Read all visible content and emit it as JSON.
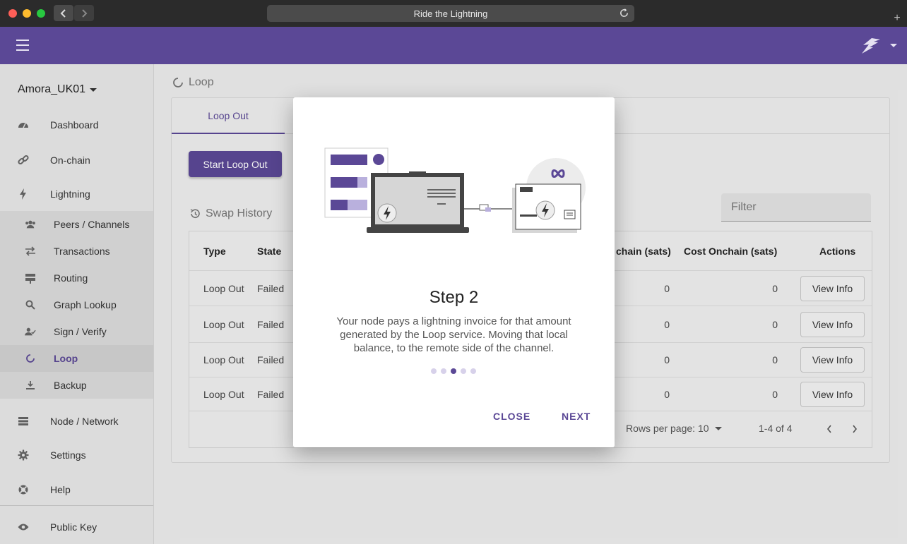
{
  "browser": {
    "url_title": "Ride the Lightning",
    "new_tab": "+"
  },
  "sidebar": {
    "node_name": "Amora_UK01",
    "items": [
      {
        "label": "Dashboard",
        "icon": "dashboard-icon"
      },
      {
        "label": "On-chain",
        "icon": "link-icon"
      },
      {
        "label": "Lightning",
        "icon": "bolt-icon"
      },
      {
        "label": "Peers / Channels",
        "icon": "people-icon"
      },
      {
        "label": "Transactions",
        "icon": "swap-arrows-icon"
      },
      {
        "label": "Routing",
        "icon": "signpost-icon"
      },
      {
        "label": "Graph Lookup",
        "icon": "search-icon"
      },
      {
        "label": "Sign / Verify",
        "icon": "user-check-icon"
      },
      {
        "label": "Loop",
        "icon": "loop-icon"
      },
      {
        "label": "Backup",
        "icon": "download-icon"
      },
      {
        "label": "Node / Network",
        "icon": "server-icon"
      },
      {
        "label": "Settings",
        "icon": "gear-icon"
      },
      {
        "label": "Help",
        "icon": "lifebuoy-icon"
      },
      {
        "label": "Public Key",
        "icon": "eye-icon"
      }
    ]
  },
  "main": {
    "breadcrumb": "Loop",
    "tab_active": "Loop Out",
    "start_button": "Start Loop Out",
    "swap_history_title": "Swap History",
    "filter_placeholder": "Filter",
    "table": {
      "headers": {
        "type": "Type",
        "state": "State",
        "onchain": "chain (sats)",
        "cost_onchain": "Cost Onchain (sats)",
        "actions": "Actions"
      },
      "rows": [
        {
          "type": "Loop Out",
          "state": "Failed",
          "onchain": "0",
          "cost_onchain": "0",
          "action": "View Info"
        },
        {
          "type": "Loop Out",
          "state": "Failed",
          "onchain": "0",
          "cost_onchain": "0",
          "action": "View Info"
        },
        {
          "type": "Loop Out",
          "state": "Failed",
          "onchain": "0",
          "cost_onchain": "0",
          "action": "View Info"
        },
        {
          "type": "Loop Out",
          "state": "Failed",
          "onchain": "0",
          "cost_onchain": "0",
          "action": "View Info"
        }
      ],
      "rows_per_page_label": "Rows per page: 10",
      "range_label": "1-4 of 4"
    }
  },
  "dialog": {
    "title": "Step 2",
    "body": "Your node pays a lightning invoice for that amount generated by the Loop service. Moving that local balance, to the remote side of the channel.",
    "current_step": 3,
    "total_steps": 5,
    "close_label": "CLOSE",
    "next_label": "NEXT"
  },
  "colors": {
    "accent": "#5b4896",
    "accent_light": "#b9b0dd"
  }
}
